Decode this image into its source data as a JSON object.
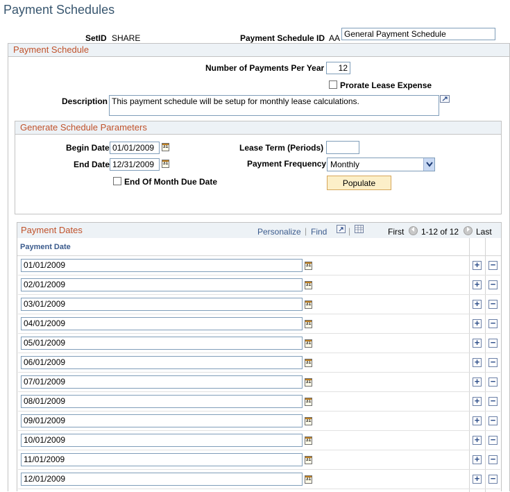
{
  "page": {
    "title": "Payment Schedules"
  },
  "header": {
    "setid_label": "SetID",
    "setid_value": "SHARE",
    "schedule_id_label": "Payment Schedule ID",
    "schedule_id_value": "AA",
    "schedule_desc_value": "General Payment Schedule"
  },
  "payment_schedule": {
    "title": "Payment Schedule",
    "num_payments_label": "Number of Payments Per Year",
    "num_payments_value": "12",
    "prorate_label": "Prorate Lease Expense",
    "prorate_checked": false,
    "description_label": "Description",
    "description_value": "This payment schedule will be setup for monthly lease calculations."
  },
  "generate": {
    "title": "Generate Schedule Parameters",
    "begin_date_label": "Begin Date",
    "begin_date_value": "01/01/2009",
    "end_date_label": "End Date",
    "end_date_value": "12/31/2009",
    "eom_label": "End Of Month Due Date",
    "lease_term_label": "Lease Term (Periods)",
    "lease_term_value": "",
    "frequency_label": "Payment Frequency",
    "frequency_value": "Monthly",
    "populate_label": "Populate"
  },
  "payment_dates": {
    "title": "Payment Dates",
    "personalize": "Personalize",
    "separator": "|",
    "find": "Find",
    "first": "First",
    "range": "1-12 of 12",
    "last": "Last",
    "column_header": "Payment Date",
    "calendar_glyph": "31",
    "add_glyph": "+",
    "remove_glyph": "−",
    "rows": [
      "01/01/2009",
      "02/01/2009",
      "03/01/2009",
      "04/01/2009",
      "05/01/2009",
      "06/01/2009",
      "07/01/2009",
      "08/01/2009",
      "09/01/2009",
      "10/01/2009",
      "11/01/2009",
      "12/01/2009"
    ]
  },
  "colors": {
    "title": "#38566f",
    "section_header": "#c0522b",
    "link": "#3a5a8c",
    "button": "#fcefc8"
  }
}
